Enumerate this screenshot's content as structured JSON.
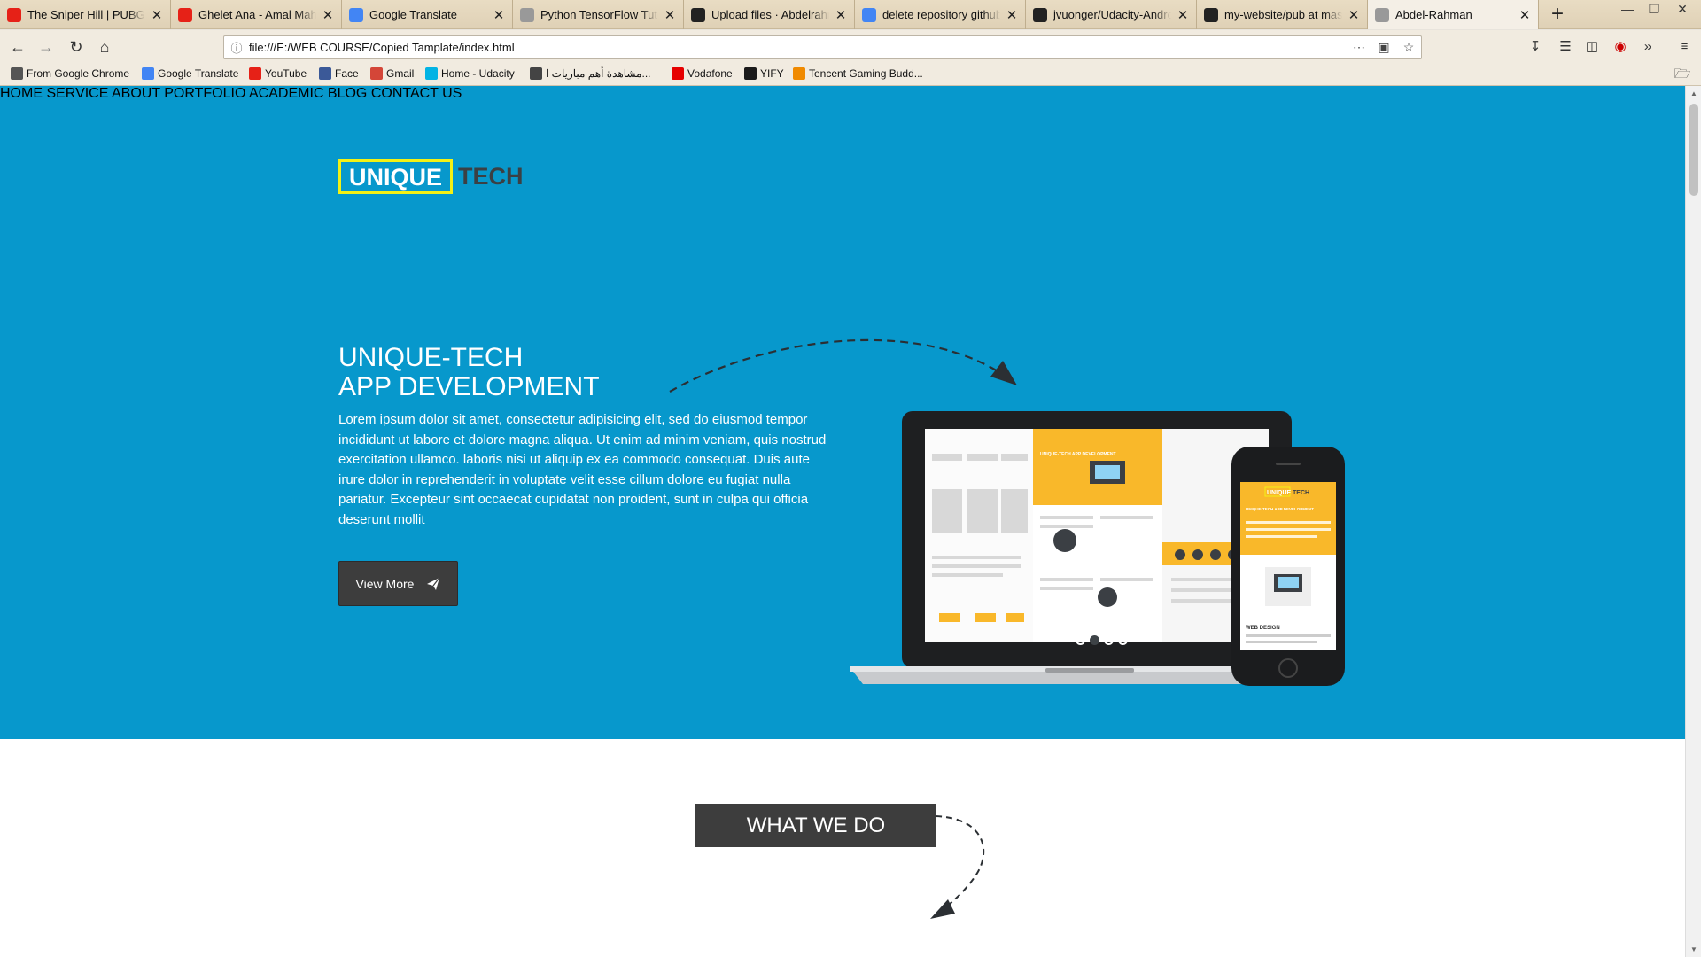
{
  "browser": {
    "tabs": [
      {
        "title": "The Sniper Hill | PUBG - YouTube",
        "icon": "youtube-icon",
        "color": "#e62117"
      },
      {
        "title": "Ghelet Ana - Amal Maher",
        "icon": "youtube-icon",
        "color": "#e62117"
      },
      {
        "title": "Google Translate",
        "icon": "google-translate-icon",
        "color": "#4285f4"
      },
      {
        "title": "Python TensorFlow Tutorial",
        "icon": "page-icon",
        "color": "#999999"
      },
      {
        "title": "Upload files · Abdelrahman",
        "icon": "github-icon",
        "color": "#222222"
      },
      {
        "title": "delete repository github",
        "icon": "google-icon",
        "color": "#4285f4"
      },
      {
        "title": "jvuonger/Udacity-Android",
        "icon": "github-icon",
        "color": "#222222"
      },
      {
        "title": "my-website/pub at master",
        "icon": "github-icon",
        "color": "#222222"
      },
      {
        "title": "Abdel-Rahman",
        "icon": "page-icon",
        "color": "#999999",
        "active": true
      }
    ],
    "new_tab": "+",
    "url": "file:///E:/WEB COURSE/Copied Tamplate/index.html",
    "bookmarks": [
      {
        "label": "From Google Chrome",
        "icon": "folder-icon",
        "color": "#555555"
      },
      {
        "label": "Google Translate",
        "icon": "google-translate-icon",
        "color": "#4285f4"
      },
      {
        "label": "YouTube",
        "icon": "youtube-icon",
        "color": "#e62117"
      },
      {
        "label": "Face",
        "icon": "facebook-icon",
        "color": "#3b5998"
      },
      {
        "label": "Gmail",
        "icon": "gmail-icon",
        "color": "#d44638"
      },
      {
        "label": "Home - Udacity",
        "icon": "udacity-icon",
        "color": "#02b3e4"
      },
      {
        "label": "مشاهدة أهم مباريات ا...",
        "icon": "ball-icon",
        "color": "#444444"
      },
      {
        "label": "Vodafone",
        "icon": "vodafone-icon",
        "color": "#e60000"
      },
      {
        "label": "YIFY",
        "icon": "yify-icon",
        "color": "#1b1b1b"
      },
      {
        "label": "Tencent Gaming Budd...",
        "icon": "tencent-icon",
        "color": "#f08a00"
      }
    ]
  },
  "page": {
    "logo": {
      "boxed": "UNIQUE",
      "rest": "TECH"
    },
    "menu": [
      "HOME",
      "SERVICE",
      "ABOUT",
      "PORTFOLIO",
      "ACADEMIC",
      "BLOG",
      "CONTACT US"
    ],
    "hero": {
      "title_line1": "UNIQUE-TECH",
      "title_line2": "APP DEVELOPMENT",
      "body": "Lorem ipsum dolor sit amet, consectetur adipisicing elit, sed do eiusmod tempor incididunt ut labore et dolore magna aliqua. Ut enim ad minim veniam, quis nostrud exercitation ullamco. laboris nisi ut aliquip ex ea commodo consequat. Duis aute irure dolor in reprehenderit in voluptate velit esse cillum dolore eu fugiat nulla pariatur. Excepteur sint occaecat cupidatat non proident, sunt in culpa qui officia deserunt mollit",
      "button": "View More",
      "slides": 4,
      "active_slide": 2
    },
    "mockup": {
      "laptop_heading": "UNIQUE-TECH APP DEVELOPMENT",
      "phone_logo_boxed": "UNIQUE",
      "phone_logo_rest": "TECH",
      "phone_heading": "UNIQUE-TECH APP DEVELOPMENT",
      "phone_caption": "WEB DESIGN"
    },
    "section_title": "WHAT WE DO"
  },
  "colors": {
    "hero_bg": "#0798cc",
    "logo_border": "#f3f115",
    "dark": "#3d3d3d",
    "accent": "#f9b82a"
  }
}
